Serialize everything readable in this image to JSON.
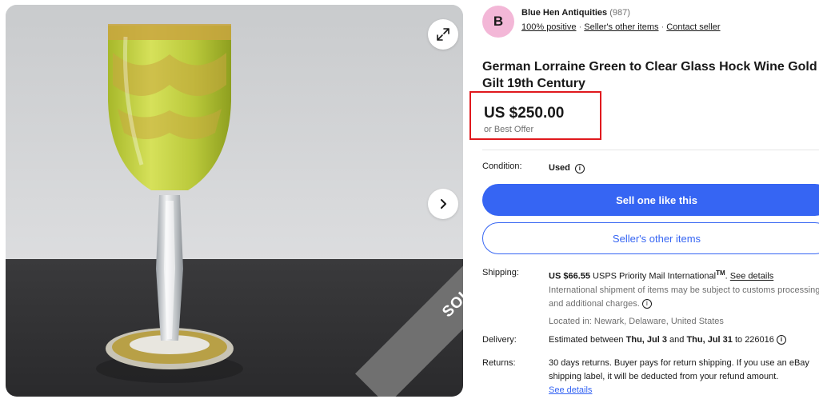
{
  "seller": {
    "avatar_letter": "B",
    "name": "Blue Hen Antiquities",
    "feedback_count": "(987)",
    "positive": "100% positive",
    "other_items": "Seller's other items",
    "contact": "Contact seller",
    "separator": "·"
  },
  "listing": {
    "title": "German Lorraine Green to Clear Glass Hock Wine Gold Gilt 19th Century",
    "price": "US $250.00",
    "best_offer": "or Best Offer",
    "sold_badge": "SOLD"
  },
  "condition": {
    "label": "Condition:",
    "value": "Used",
    "info_icon": "info-icon"
  },
  "buttons": {
    "sell_one": "Sell one like this",
    "sellers_other_items": "Seller's other items"
  },
  "shipping": {
    "label": "Shipping:",
    "amount": "US $66.55",
    "service": " USPS Priority Mail International",
    "tm": "TM",
    "see_details": "See details",
    "note": "International shipment of items may be subject to customs processing and additional charges.",
    "location": "Located in: Newark, Delaware, United States"
  },
  "delivery": {
    "label": "Delivery:",
    "prefix": "Estimated between ",
    "date_start": "Thu, Jul 3",
    "and": " and ",
    "date_end": "Thu, Jul 31",
    "to": " to 226016"
  },
  "returns": {
    "label": "Returns:",
    "text": "30 days returns. Buyer pays for return shipping. If you use an eBay shipping label, it will be deducted from your refund amount.",
    "see_details": "See details"
  },
  "colors": {
    "accent_blue": "#3665f3",
    "highlight_red": "#e0191e",
    "avatar_pink": "#f3b7d7",
    "sold_ribbon": "#707070"
  }
}
